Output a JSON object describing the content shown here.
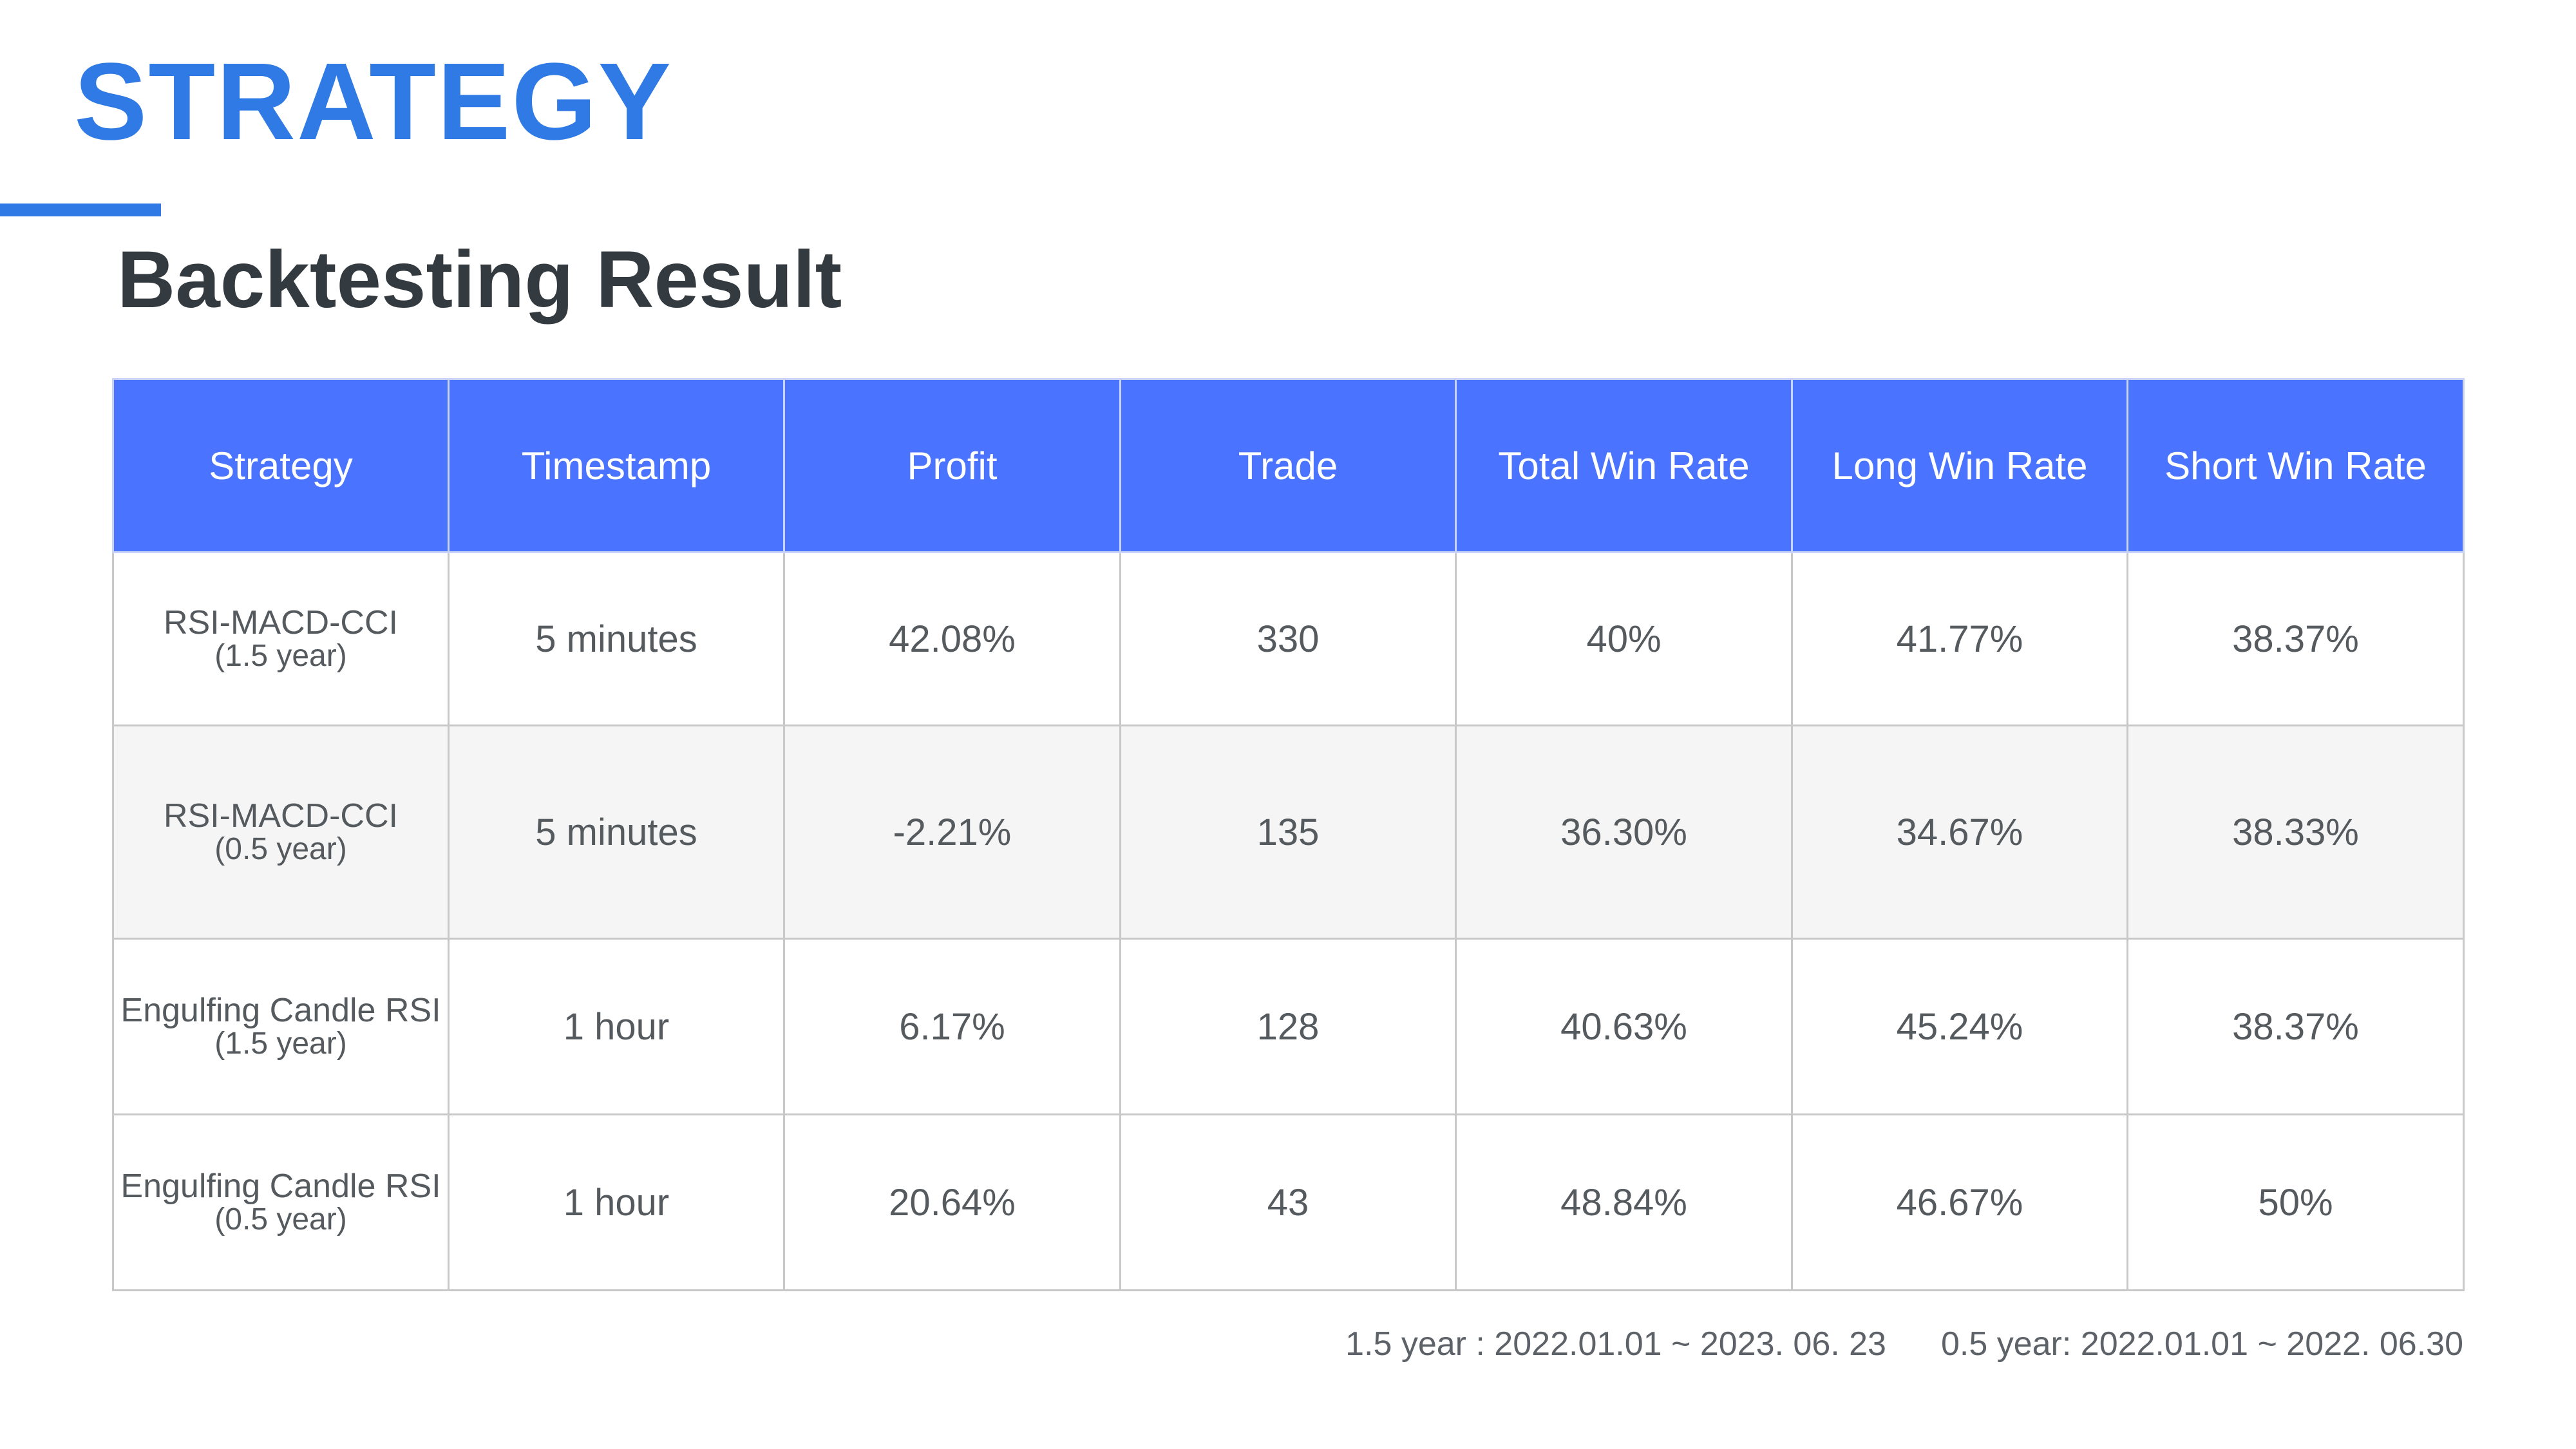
{
  "header": {
    "section_title": "STRATEGY",
    "sub_title": "Backtesting Result",
    "accent_color": "#2f7ae5"
  },
  "table": {
    "header_color": "#4a73ff",
    "columns": [
      "Strategy",
      "Timestamp",
      "Profit",
      "Trade",
      "Total Win Rate",
      "Long Win Rate",
      "Short Win Rate"
    ],
    "rows": [
      {
        "strategy": "RSI-MACD-CCI",
        "period": "(1.5 year)",
        "timestamp": "5 minutes",
        "profit": "42.08%",
        "trade": "330",
        "total_win_rate": "40%",
        "long_win_rate": "41.77%",
        "short_win_rate": "38.37%"
      },
      {
        "strategy": "RSI-MACD-CCI",
        "period": "(0.5 year)",
        "timestamp": "5 minutes",
        "profit": "-2.21%",
        "trade": "135",
        "total_win_rate": "36.30%",
        "long_win_rate": "34.67%",
        "short_win_rate": "38.33%"
      },
      {
        "strategy": "Engulfing Candle RSI",
        "period": "(1.5 year)",
        "timestamp": "1 hour",
        "profit": "6.17%",
        "trade": "128",
        "total_win_rate": "40.63%",
        "long_win_rate": "45.24%",
        "short_win_rate": "38.37%"
      },
      {
        "strategy": "Engulfing Candle RSI",
        "period": "(0.5 year)",
        "timestamp": "1 hour",
        "profit": "20.64%",
        "trade": "43",
        "total_win_rate": "48.84%",
        "long_win_rate": "46.67%",
        "short_win_rate": "50%"
      }
    ]
  },
  "footnotes": [
    "1.5 year : 2022.01.01 ~ 2023. 06. 23",
    "0.5 year: 2022.01.01 ~ 2022. 06.30"
  ]
}
